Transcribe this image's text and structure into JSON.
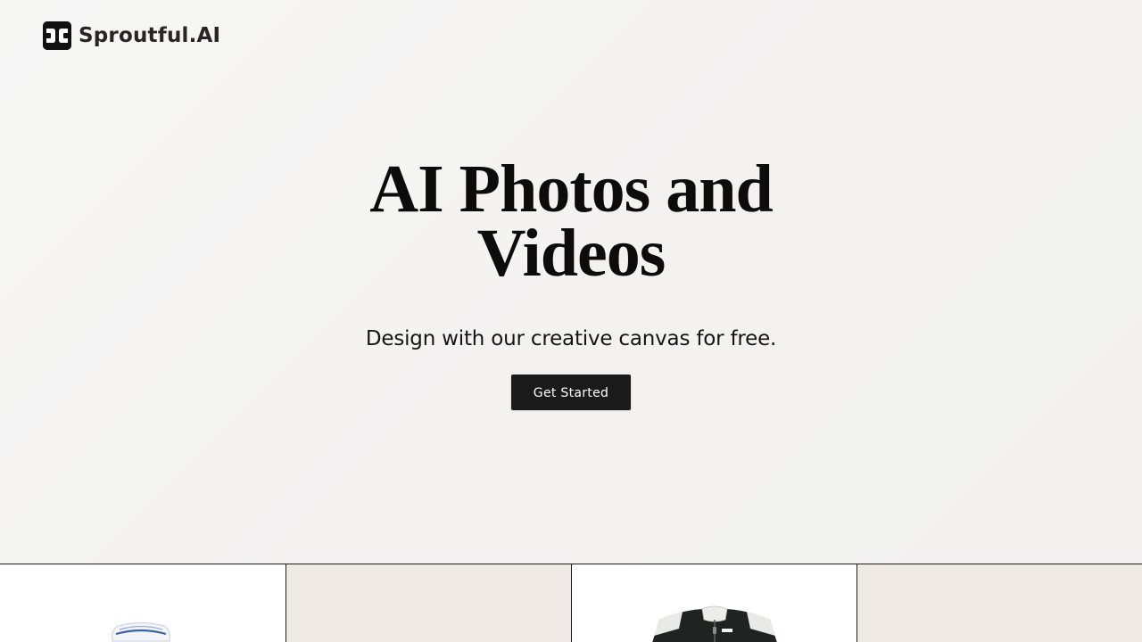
{
  "brand": {
    "name": "Sproutful.AI",
    "logo_icon": "sproutful-logo-icon"
  },
  "hero": {
    "title_line1": "AI Photos and",
    "title_line2": "Videos",
    "subtitle": "Design with our creative canvas for free.",
    "cta_label": "Get Started"
  },
  "gallery": {
    "tiles": [
      {
        "product": "white-blue-product-icon",
        "background": "#ffffff"
      },
      {
        "product": "empty",
        "background": "#eee9e3"
      },
      {
        "product": "black-white-jacket-icon",
        "background": "#ffffff"
      },
      {
        "product": "empty",
        "background": "#eee9e3"
      }
    ]
  },
  "colors": {
    "accent": "#1a1a1a",
    "page_background": "#f4f3f2",
    "text": "#111111"
  }
}
